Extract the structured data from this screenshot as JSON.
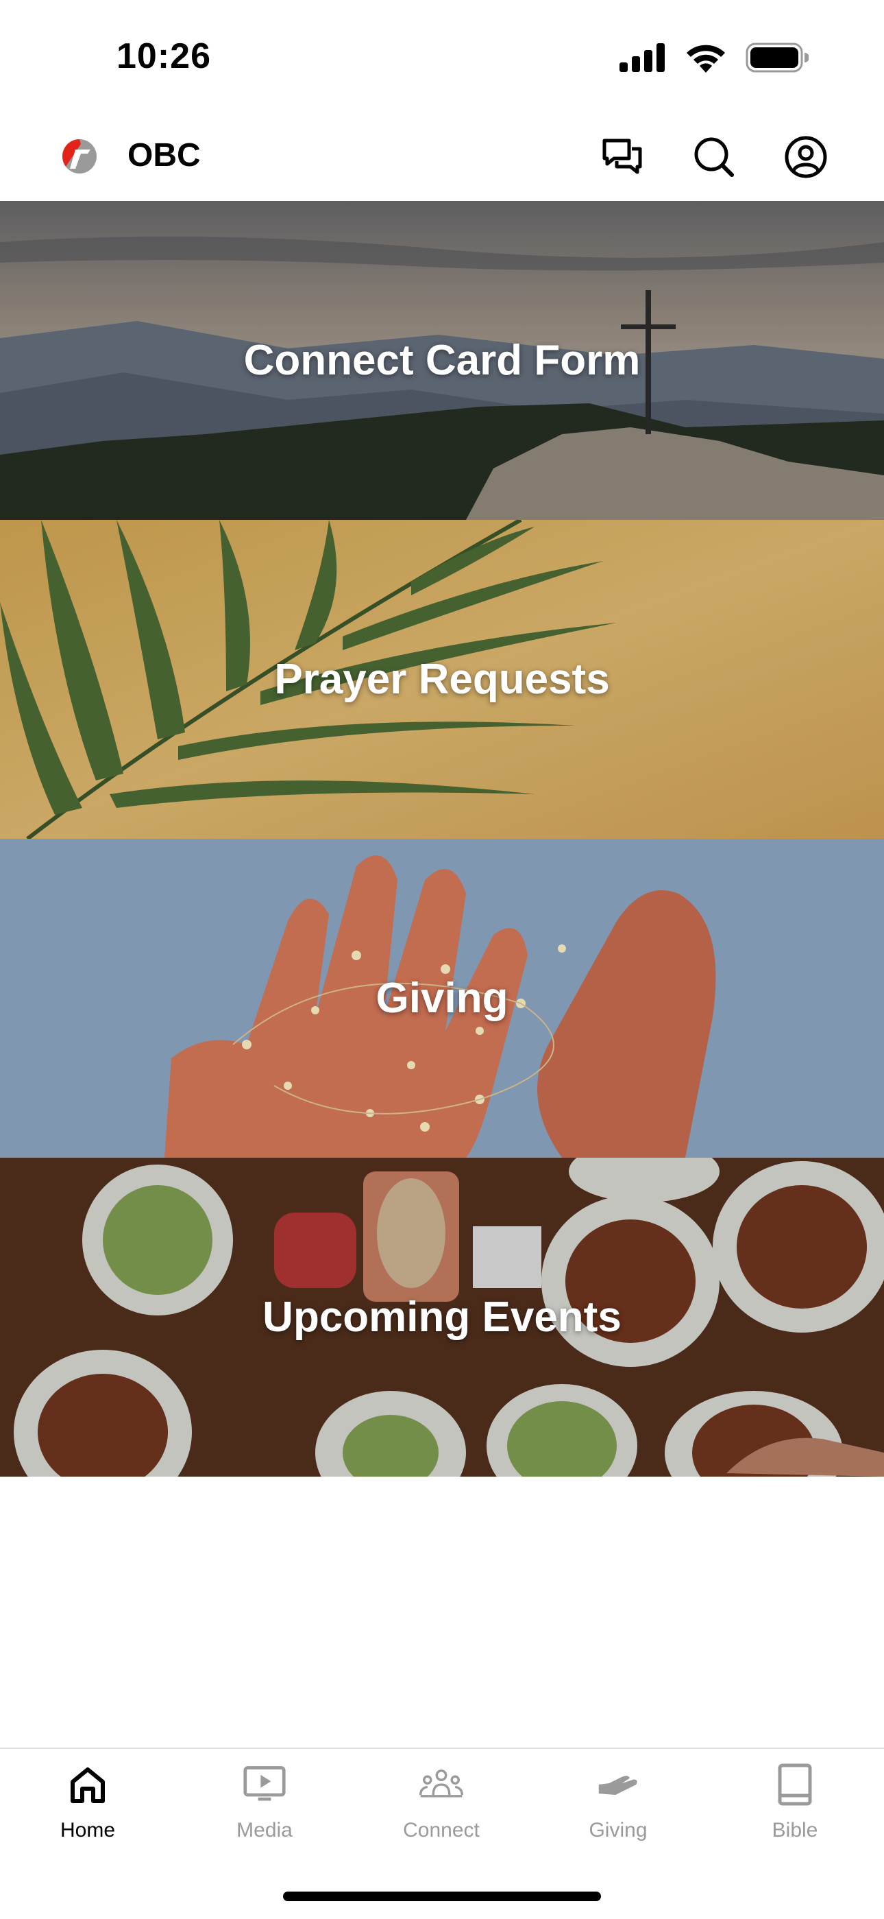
{
  "status_bar": {
    "time": "10:26"
  },
  "header": {
    "app_name": "OBC"
  },
  "tiles": [
    {
      "label": "Connect Card Form"
    },
    {
      "label": "Prayer Requests"
    },
    {
      "label": "Giving"
    },
    {
      "label": "Upcoming Events"
    }
  ],
  "tab_bar": {
    "active": "Home",
    "tabs": [
      {
        "label": "Home",
        "icon": "home-icon"
      },
      {
        "label": "Media",
        "icon": "media-icon"
      },
      {
        "label": "Connect",
        "icon": "people-icon"
      },
      {
        "label": "Giving",
        "icon": "giving-hand-icon"
      },
      {
        "label": "Bible",
        "icon": "book-icon"
      }
    ]
  },
  "colors": {
    "logo_red": "#e2231a",
    "logo_gray": "#8a8a8a",
    "inactive_tab": "#9a9a9a"
  }
}
